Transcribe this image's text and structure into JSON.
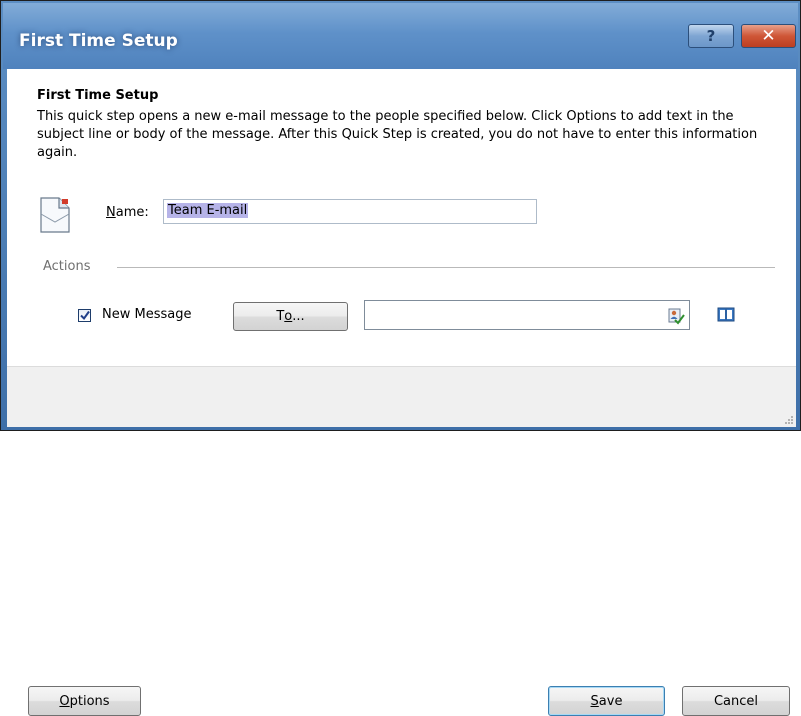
{
  "window": {
    "title": "First Time Setup",
    "help_glyph": "?",
    "close_glyph": "✕"
  },
  "content": {
    "heading": "First Time Setup",
    "description": "This quick step opens a new e-mail message to the people specified below. Click Options to add text in the subject line or body of the message. After this Quick Step is created, you do not have to enter this information again.",
    "name_label_mnemonic": "N",
    "name_label_rest": "ame:",
    "name_value": "Team E-mail"
  },
  "actions": {
    "section_label": "Actions",
    "new_message_label": "New Message",
    "new_message_checked": true,
    "to_button_pre": "T",
    "to_button_mnemonic": "o",
    "to_button_post": "...",
    "to_value": ""
  },
  "footer": {
    "options_mnemonic": "O",
    "options_rest": "ptions",
    "save_mnemonic": "S",
    "save_rest": "ave",
    "cancel_label": "Cancel"
  },
  "colors": {
    "titlebar": "#5f91c9",
    "close_button": "#cf5637",
    "selection": "#b6b3e8",
    "footer_bg": "#f0f0f0"
  },
  "icons": [
    "quick-step-document-icon",
    "check-names-icon",
    "address-book-icon",
    "help-icon",
    "close-icon",
    "checkmark-icon",
    "resize-grip-icon"
  ]
}
